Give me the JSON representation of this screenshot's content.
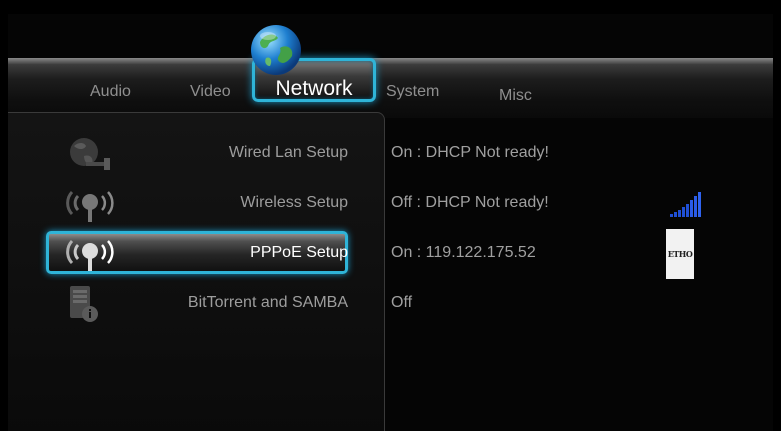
{
  "tabs": {
    "audio": "Audio",
    "video": "Video",
    "network": "Network",
    "system": "System",
    "misc": "Misc"
  },
  "menu": {
    "items": [
      {
        "label": "Wired Lan Setup",
        "icon": "wired-lan-icon",
        "status": "On : DHCP Not ready!"
      },
      {
        "label": "Wireless Setup",
        "icon": "wireless-icon",
        "status": "Off : DHCP Not ready!"
      },
      {
        "label": "PPPoE Setup",
        "icon": "pppoe-antenna-icon",
        "status": "On : 119.122.175.52",
        "selected": true
      },
      {
        "label": "BitTorrent and SAMBA",
        "icon": "bittorrent-samba-icon",
        "status": "Off"
      }
    ]
  },
  "pppoe_badge": "ETHO",
  "colors": {
    "accent": "#2fb4d8",
    "signal": "#1f4fd6",
    "text": "#9d9d9d",
    "active_text": "#ffffff"
  }
}
